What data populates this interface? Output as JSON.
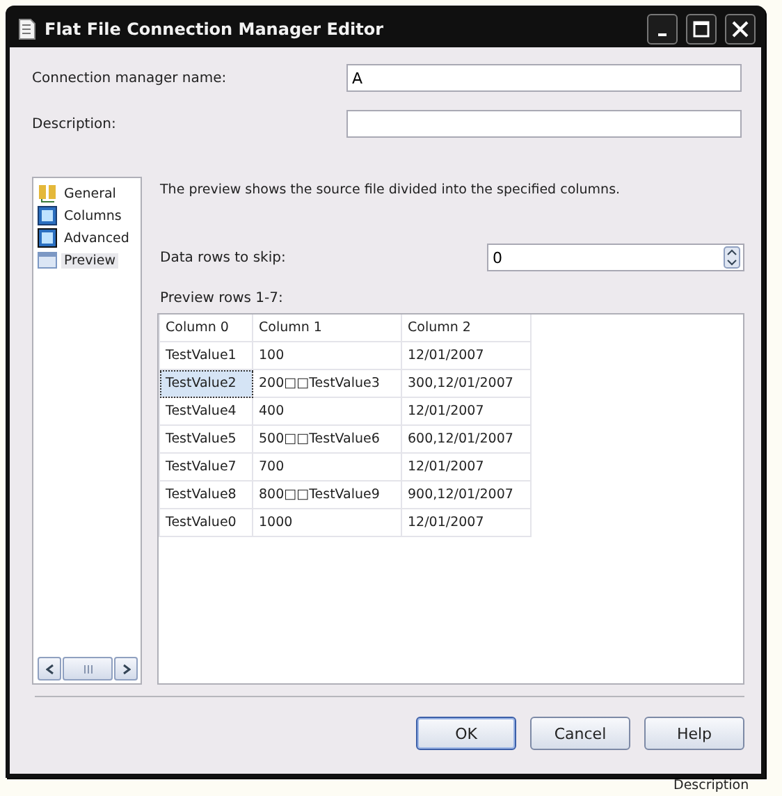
{
  "window": {
    "title": "Flat File Connection Manager Editor"
  },
  "fields": [
    {
      "label": "Connection manager name:",
      "value": "A"
    },
    {
      "label": "Description:"
    }
  ],
  "nav": [
    {
      "label": "General",
      "selected": false
    },
    {
      "label": "Columns",
      "selected": false
    },
    {
      "label": "Advanced",
      "selected": false
    },
    {
      "label": "Preview",
      "selected": true
    }
  ],
  "intro": "The preview shows the source file divided into the specified columns.",
  "skip": {
    "label": "Data rows to skip:",
    "value": "0"
  },
  "preview_label": "Preview rows 1-7:",
  "table": {
    "columns": [
      "Column 0",
      "Column 1",
      "Column 2"
    ],
    "rows": [
      {
        "cells": [
          "TestValue1",
          "100",
          "12/01/2007"
        ],
        "selected": false
      },
      {
        "cells": [
          "TestValue2",
          "200□□TestValue3",
          "300,12/01/2007"
        ],
        "selected": true
      },
      {
        "cells": [
          "TestValue4",
          "400",
          "12/01/2007"
        ],
        "selected": false
      },
      {
        "cells": [
          "TestValue5",
          "500□□TestValue6",
          "600,12/01/2007"
        ],
        "selected": false
      },
      {
        "cells": [
          "TestValue7",
          "700",
          "12/01/2007"
        ],
        "selected": false
      },
      {
        "cells": [
          "TestValue8",
          "800□□TestValue9",
          "900,12/01/2007"
        ],
        "selected": false
      },
      {
        "cells": [
          "TestValue0",
          "1000",
          "12/01/2007"
        ],
        "selected": false
      }
    ]
  },
  "buttons": [
    {
      "label": "OK",
      "default": true
    },
    {
      "label": "Cancel",
      "default": false
    },
    {
      "label": "Help",
      "default": false
    }
  ],
  "background_text": "Description"
}
